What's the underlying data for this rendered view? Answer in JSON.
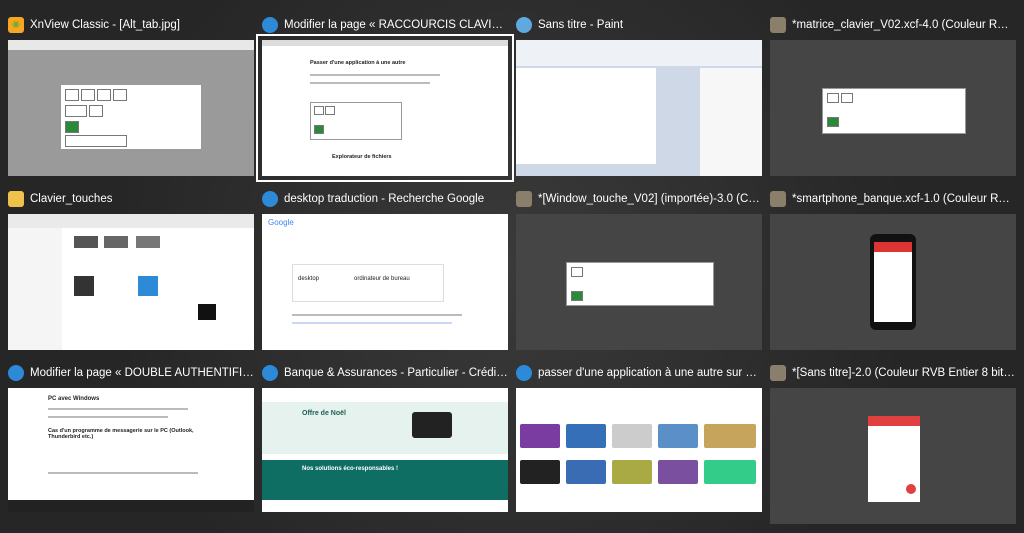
{
  "windows": [
    {
      "id": "xnview",
      "title": "XnView Classic - [Alt_tab.jpg]",
      "icon": "xnview-icon",
      "icon_color": "#f5a623"
    },
    {
      "id": "edge",
      "title": "Modifier la page « RACCOURCIS CLAVIER W...",
      "icon": "edge-icon",
      "icon_color": "#2c8ad8",
      "selected": true
    },
    {
      "id": "paint",
      "title": "Sans titre - Paint",
      "icon": "paint-icon",
      "icon_color": "#5fa8e0"
    },
    {
      "id": "gimp1",
      "title": "*matrice_clavier_V02.xcf-4.0 (Couleur RVB E...",
      "icon": "gimp-icon",
      "icon_color": "#8a7f6b"
    },
    {
      "id": "explorer",
      "title": "Clavier_touches",
      "icon": "folder-icon",
      "icon_color": "#f0c24b"
    },
    {
      "id": "google",
      "title": "desktop traduction - Recherche Google",
      "icon": "edge-icon",
      "icon_color": "#2c8ad8"
    },
    {
      "id": "gimp2",
      "title": "*[Window_touche_V02] (importée)-3.0 (Cou...",
      "icon": "gimp-icon",
      "icon_color": "#8a7f6b"
    },
    {
      "id": "gimp3",
      "title": "*smartphone_banque.xcf-1.0 (Couleur RVB...",
      "icon": "gimp-icon",
      "icon_color": "#8a7f6b"
    },
    {
      "id": "edge2",
      "title": "Modifier la page « DOUBLE AUTHENTIFICA...",
      "icon": "edge-icon",
      "icon_color": "#2c8ad8"
    },
    {
      "id": "bank",
      "title": "Banque & Assurances - Particulier - Crédit...",
      "icon": "edge-icon",
      "icon_color": "#2c8ad8"
    },
    {
      "id": "gimages",
      "title": "passer d'une application à une autre sur un...",
      "icon": "edge-icon",
      "icon_color": "#2c8ad8"
    },
    {
      "id": "gimp4",
      "title": "*[Sans titre]-2.0 (Couleur RVB Entier 8 bits...",
      "icon": "gimp-icon",
      "icon_color": "#8a7f6b"
    }
  ],
  "previews": {
    "edge_heading_1": "Passer d'une application à une autre",
    "edge_heading_2": "Explorateur de fichiers",
    "google_query": "desktop",
    "google_result": "ordinateur de bureau",
    "bank_banner": "Offre de Noël",
    "bank_section": "Nos solutions éco-responsables !",
    "edge2_heading": "PC avec Windows",
    "edge2_sub": "Cas d'un programme de messagerie sur le PC (Outlook, Thunderbird etc.)",
    "google_logo": "Google"
  }
}
